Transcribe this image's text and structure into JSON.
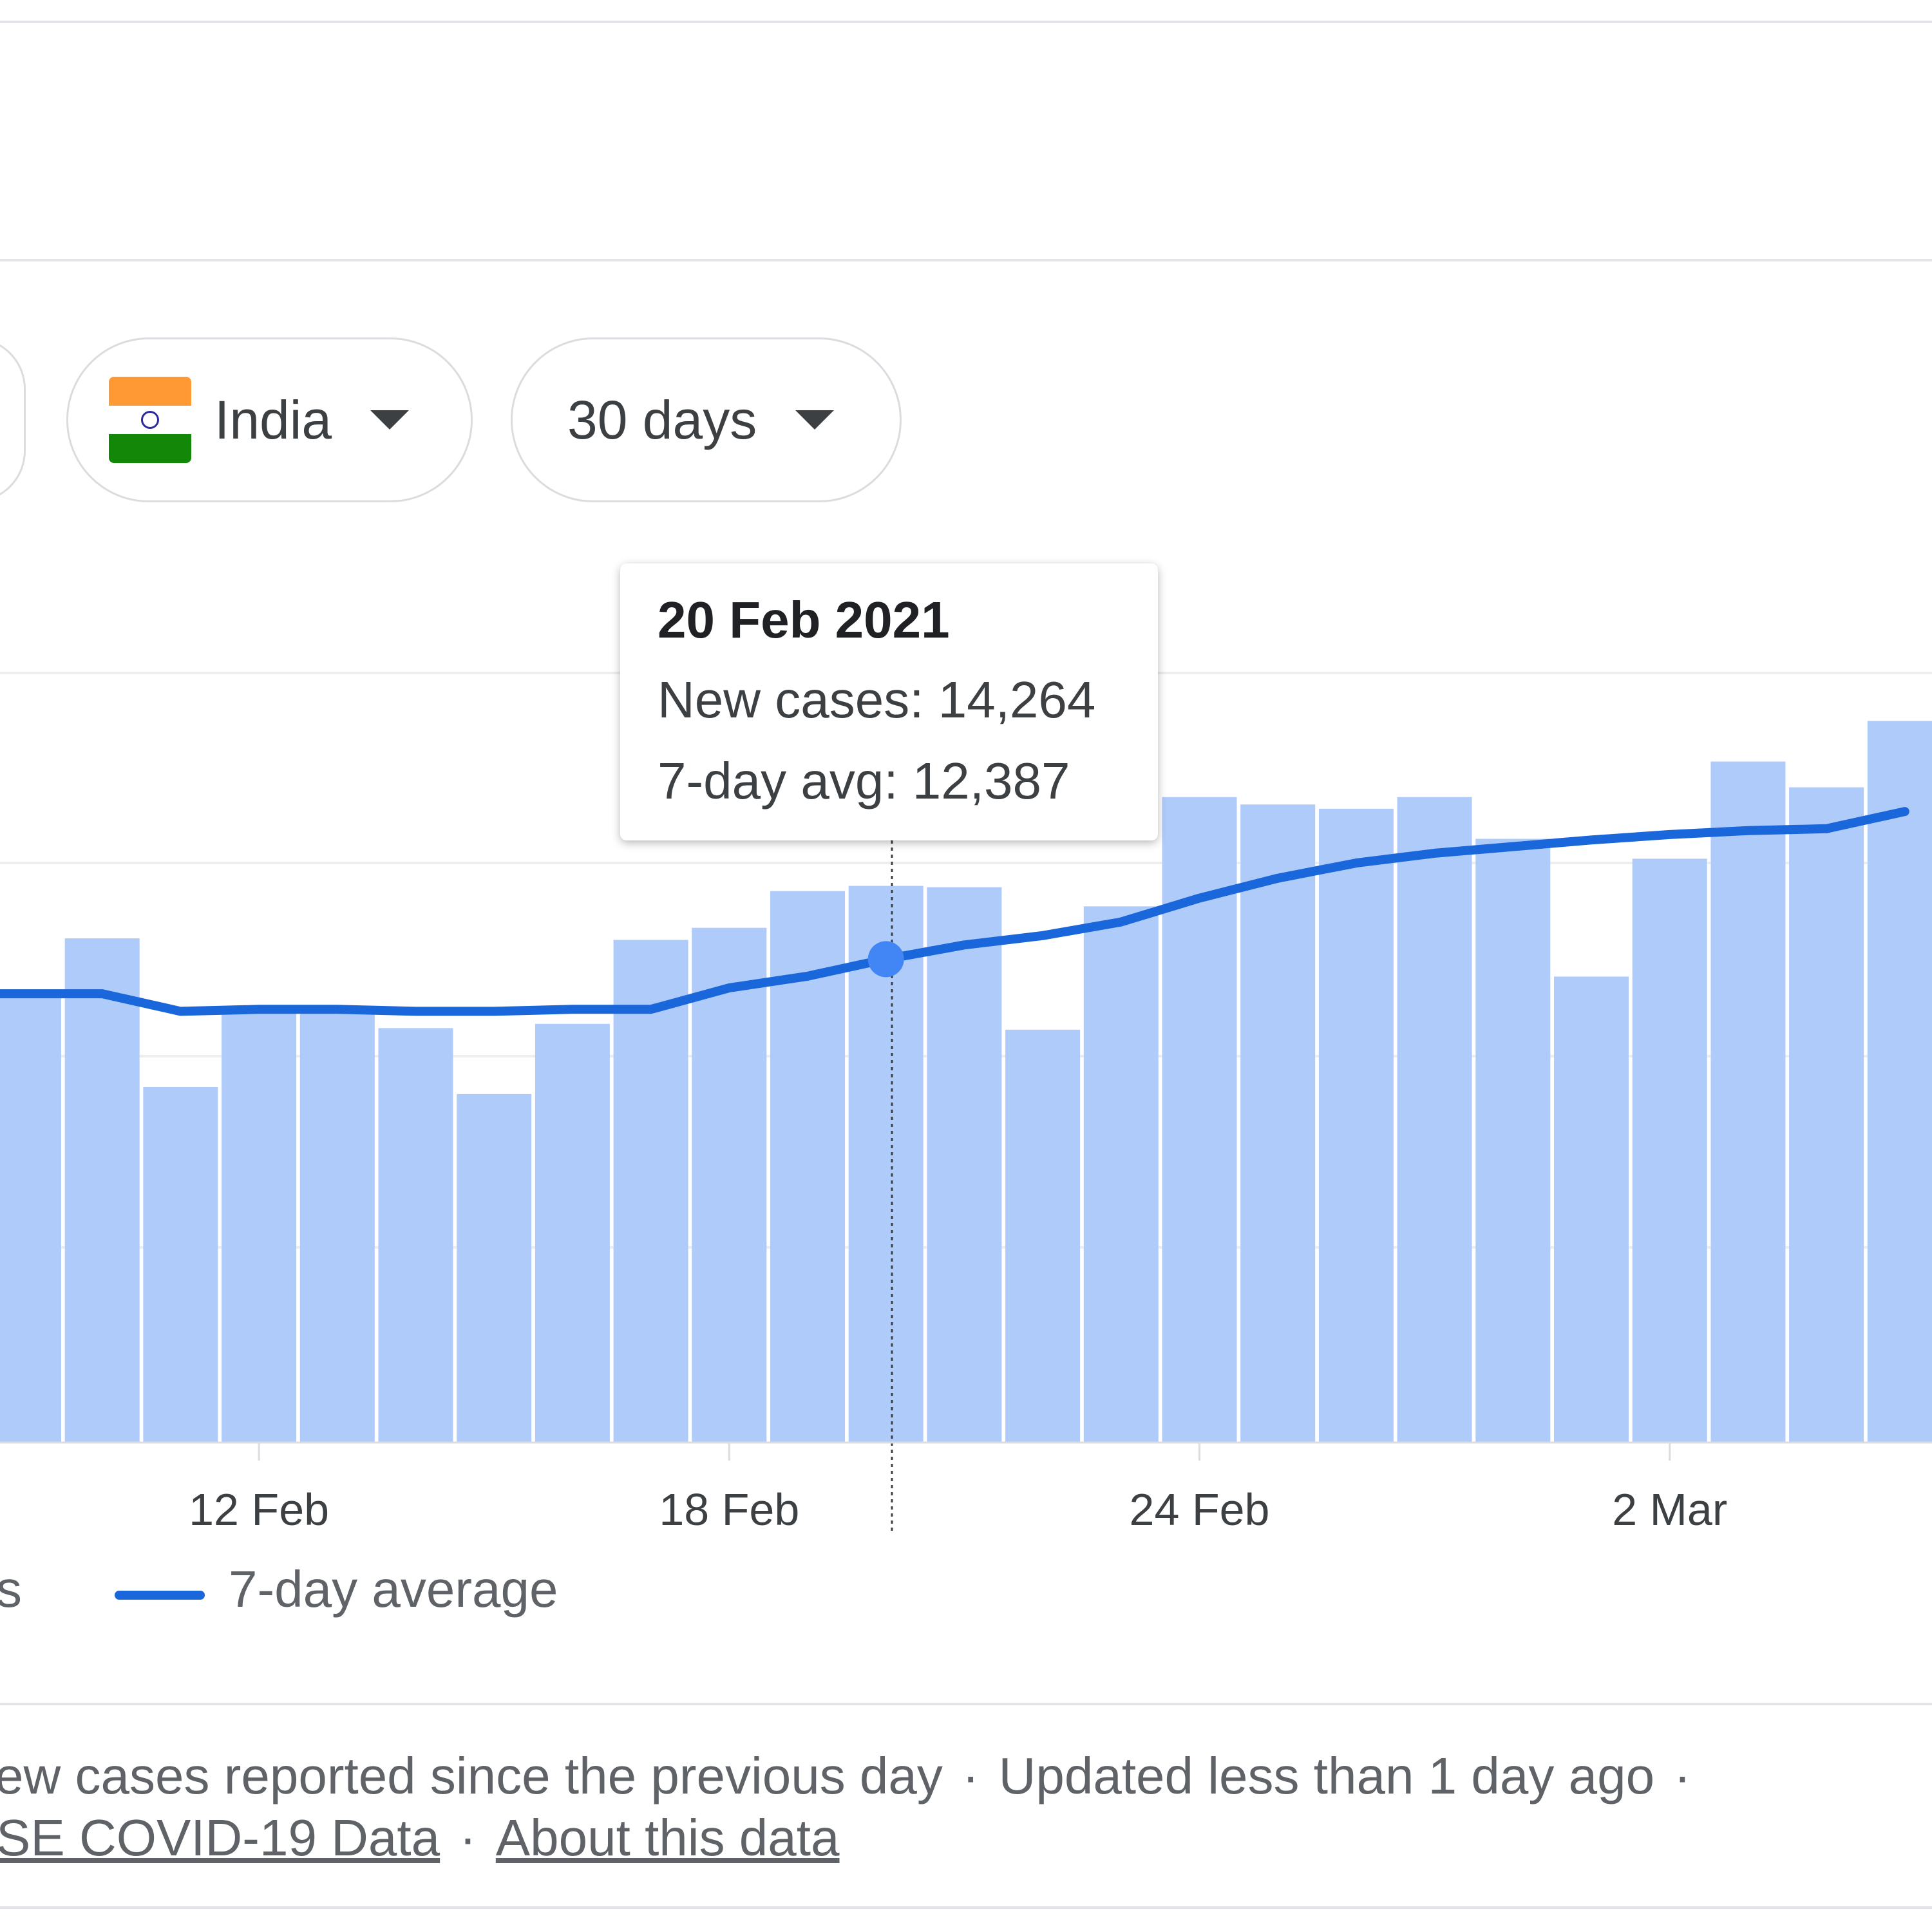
{
  "filters": {
    "country_label": "India",
    "range_label": "30 days"
  },
  "colors": {
    "bar_fill": "#aecbfa",
    "line_stroke": "#1a66db",
    "grid": "#eeeeee",
    "hover_point": "#4285f4"
  },
  "tooltip": {
    "date": "20 Feb 2021",
    "new_cases": "New cases: 14,264",
    "avg": "7-day avg: 12,387"
  },
  "legend": {
    "partial_label": "s",
    "avg_label": "7-day average"
  },
  "footer": {
    "description": "ew cases reported since the previous day",
    "sep1": "·",
    "updated": "Updated less than 1 day ago",
    "sep2": "·",
    "source_link": "SE COVID-19 Data",
    "sep3": "·",
    "about_link": "About this data"
  },
  "chart_data": {
    "type": "bar",
    "categories": [
      "9 Feb",
      "10 Feb",
      "11 Feb",
      "12 Feb",
      "13 Feb",
      "14 Feb",
      "15 Feb",
      "16 Feb",
      "17 Feb",
      "18 Feb",
      "19 Feb",
      "20 Feb",
      "21 Feb",
      "22 Feb",
      "23 Feb",
      "24 Feb",
      "25 Feb",
      "26 Feb",
      "27 Feb",
      "28 Feb",
      "1 Mar",
      "2 Mar",
      "3 Mar",
      "4 Mar",
      "5 Mar"
    ],
    "series": [
      {
        "name": "",
        "type": "bar",
        "values": [
          11610,
          12920,
          9110,
          11070,
          11150,
          10620,
          8930,
          10730,
          12880,
          13190,
          14130,
          14264,
          14230,
          10580,
          13740,
          16540,
          16350,
          16240,
          16540,
          15470,
          11940,
          14960,
          17450,
          16790,
          18490
        ]
      },
      {
        "name": "7-day average",
        "type": "line",
        "values": [
          11500,
          11500,
          11050,
          11100,
          11100,
          11050,
          11050,
          11100,
          11100,
          11650,
          11950,
          12387,
          12750,
          12990,
          13340,
          13950,
          14460,
          14850,
          15100,
          15270,
          15440,
          15580,
          15680,
          15730,
          16170
        ]
      }
    ],
    "x_tick_labels": [
      "12 Feb",
      "18 Feb",
      "24 Feb",
      "2 Mar"
    ],
    "highlighted": "20 Feb",
    "grid": true,
    "legend": "bottom-left"
  }
}
